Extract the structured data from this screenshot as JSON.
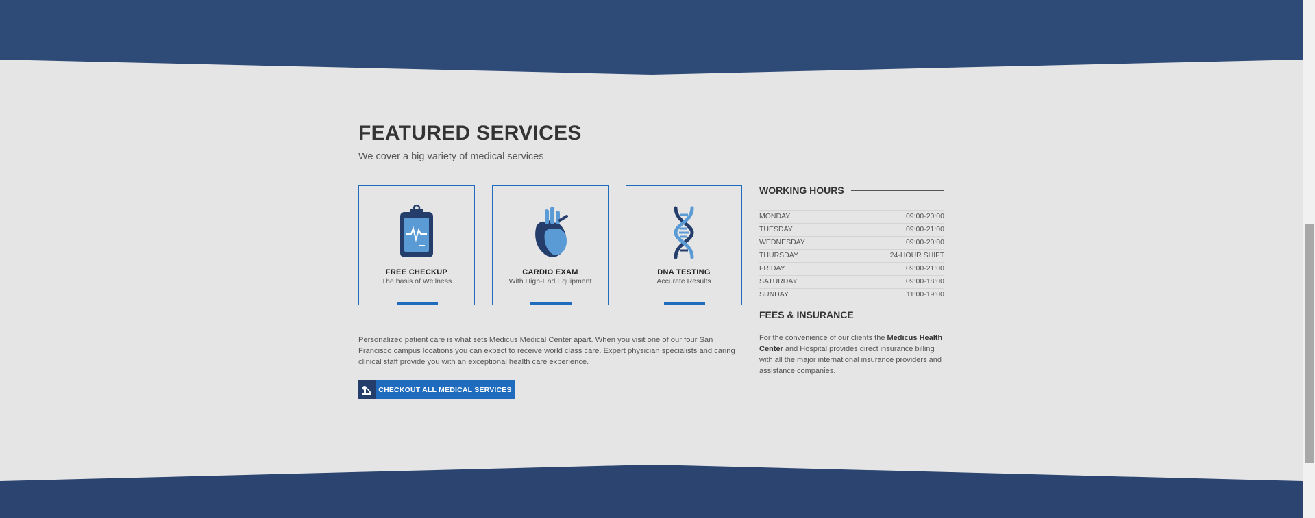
{
  "colors": {
    "navy_band": "#2e4a77",
    "accent_blue": "#1f6bbd",
    "light_blue": "#5b9bd5",
    "dark_navy": "#243d6b",
    "background": "#e5e5e5"
  },
  "featured": {
    "title": "FEATURED SERVICES",
    "subtitle": "We cover a big variety of medical services"
  },
  "services": [
    {
      "title": "FREE CHECKUP",
      "subtitle": "The basis of Wellness",
      "icon": "clipboard-heartbeat-icon"
    },
    {
      "title": "CARDIO EXAM",
      "subtitle": "With High-End Equipment",
      "icon": "heart-icon"
    },
    {
      "title": "DNA TESTING",
      "subtitle": "Accurate Results",
      "icon": "dna-icon"
    }
  ],
  "intro_text": "Personalized patient care is what sets Medicus Medical Center apart. When you visit one of our four San Francisco campus locations you can expect to receive world class care. Expert physician specialists and caring clinical staff provide you with an exceptional health care experience.",
  "cta": {
    "label": "CHECKOUT ALL MEDICAL SERVICES",
    "icon": "microscope-icon"
  },
  "working_hours": {
    "title": "WORKING HOURS",
    "rows": [
      {
        "day": "MONDAY",
        "hours": "09:00-20:00"
      },
      {
        "day": "TUESDAY",
        "hours": "09:00-21:00"
      },
      {
        "day": "WEDNESDAY",
        "hours": "09:00-20:00"
      },
      {
        "day": "THURSDAY",
        "hours": "24-HOUR SHIFT"
      },
      {
        "day": "FRIDAY",
        "hours": "09:00-21:00"
      },
      {
        "day": "SATURDAY",
        "hours": "09:00-18:00"
      },
      {
        "day": "SUNDAY",
        "hours": "11:00-19:00"
      }
    ]
  },
  "fees": {
    "title": "FEES & INSURANCE",
    "text_before": "For the convenience of our clients the ",
    "text_bold": "Medicus Health Center",
    "text_after": " and Hospital provides direct insurance billing with all the major international insurance providers and assistance companies."
  }
}
